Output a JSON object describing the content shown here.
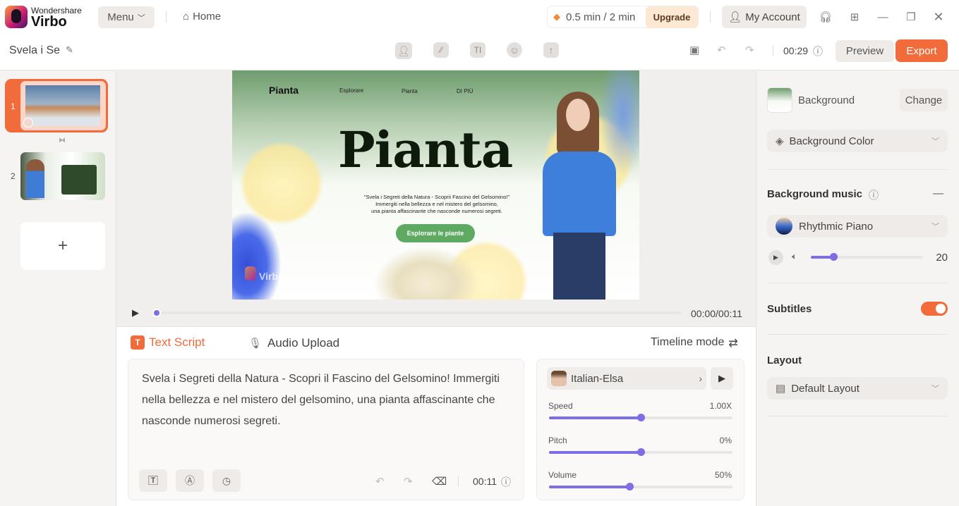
{
  "app": {
    "brand_top": "Wondershare",
    "brand_name": "Virbo",
    "menu": "Menu",
    "home": "Home",
    "usage": "0.5 min / 2 min",
    "upgrade": "Upgrade",
    "account": "My Account"
  },
  "toolbar": {
    "project_name": "Svela i Se",
    "duration": "00:29",
    "preview": "Preview",
    "export": "Export"
  },
  "slides": {
    "items": [
      {
        "number": "1"
      },
      {
        "number": "2"
      }
    ],
    "add": "+"
  },
  "canvas": {
    "nav_logo": "Pianta",
    "nav": [
      "Esplorare",
      "Pianta",
      "DI PIÙ"
    ],
    "headline": "Pianta",
    "quote": "\"Svela i Segreti della Natura - Scoprii Fascino del Gelsomino!\"",
    "line2": "Immergiti nella bellezza e nel mistero del gelsomino,",
    "line3": "una pianta affascinante che nasconde numerosi segreti.",
    "cta": "Esplorare le piante",
    "watermark": "Virbo"
  },
  "player": {
    "time": "00:00/00:11",
    "progress": 0
  },
  "script": {
    "tab_text": "Text Script",
    "tab_audio": "Audio Upload",
    "timeline_mode": "Timeline mode",
    "body": "Svela i Segreti della Natura - Scopri il Fascino del Gelsomino! Immergiti nella bellezza e nel mistero del gelsomino, una pianta affascinante che nasconde numerosi segreti.",
    "duration": "00:11"
  },
  "voice": {
    "name": "Italian-Elsa",
    "speed_label": "Speed",
    "speed_value": "1.00X",
    "speed_pct": 50,
    "pitch_label": "Pitch",
    "pitch_value": "0%",
    "pitch_pct": 50,
    "volume_label": "Volume",
    "volume_value": "50%",
    "volume_pct": 44
  },
  "right": {
    "background": "Background",
    "change": "Change",
    "bg_color": "Background Color",
    "music_title": "Background music",
    "music_name": "Rhythmic Piano",
    "music_volume": "20",
    "music_volume_pct": 20,
    "subtitles": "Subtitles",
    "subtitles_on": true,
    "layout": "Layout",
    "layout_value": "Default Layout"
  },
  "colors": {
    "accent": "#f26b3a",
    "slider": "#7b6ee6"
  }
}
